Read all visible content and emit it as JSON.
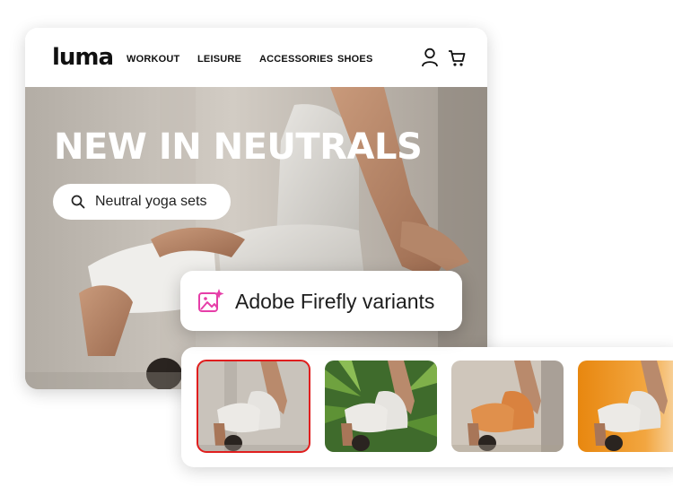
{
  "brand": {
    "logo_text": "luma"
  },
  "nav": {
    "items": [
      {
        "label": "WORKOUT"
      },
      {
        "label": "LEISURE"
      },
      {
        "label": "ACCESSORIES"
      },
      {
        "label": "SHOES"
      }
    ],
    "account_icon": "user-icon",
    "cart_icon": "cart-icon"
  },
  "hero": {
    "title": "NEW IN NEUTRALS",
    "search": {
      "value": "Neutral yoga sets",
      "icon": "search-icon"
    }
  },
  "firefly": {
    "label": "Adobe Firefly variants",
    "icon": "firefly-generative-icon",
    "accent": "#e63ea8"
  },
  "variants": {
    "selected_index": 0,
    "selected_color": "#e01e1e",
    "items": [
      {
        "background": "neutral studio"
      },
      {
        "background": "palm leaves"
      },
      {
        "background": "beige studio, orange outfit"
      },
      {
        "background": "orange gradient"
      }
    ]
  }
}
